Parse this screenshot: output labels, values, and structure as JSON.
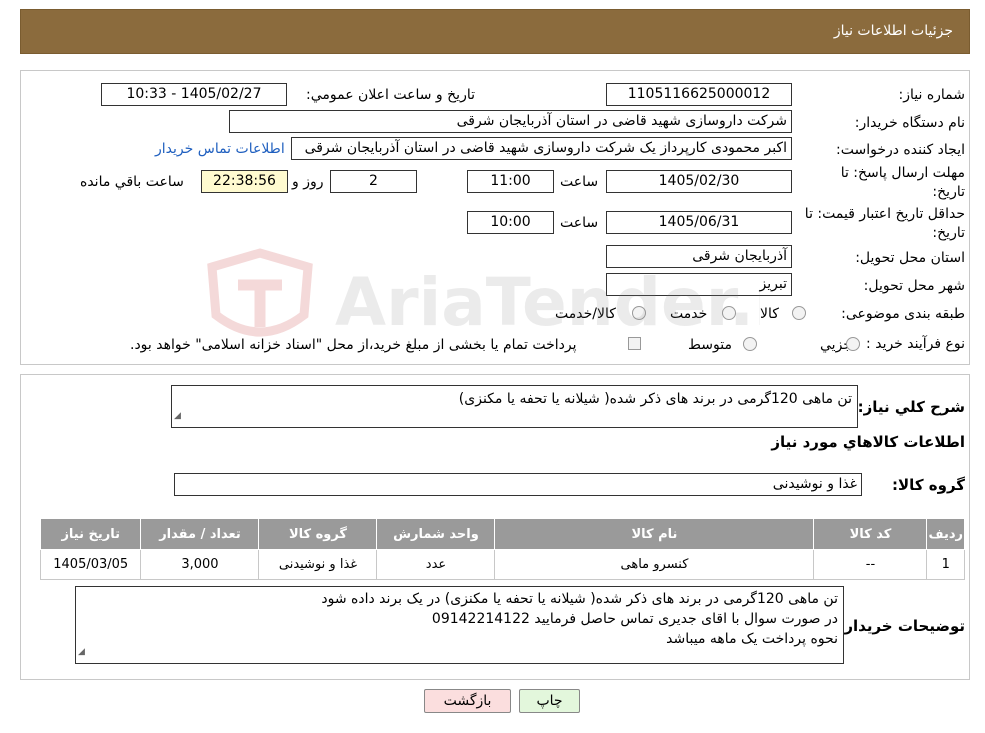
{
  "header": {
    "title": "جزئیات اطلاعات نیاز"
  },
  "info": {
    "need_number_label": "شماره نیاز:",
    "need_number": "1105116625000012",
    "announce_label": "تاریخ و ساعت اعلان عمومي:",
    "announce_value": "1405/02/27 - 10:33",
    "buyer_org_label": "نام دستگاه خریدار:",
    "buyer_org": "شرکت داروسازی شهید قاضی در استان آذربایجان شرقی",
    "creator_label": "ایجاد کننده درخواست:",
    "creator": "اکبر محمودی  کارپرداز یک  شرکت داروسازی شهید قاضی در استان آذربایجان شرقی",
    "contact_link": "اطلاعات تماس خریدار",
    "deadline_label_1": "مهلت ارسال پاسخ: تا",
    "deadline_label_2": "تاریخ:",
    "deadline_date": "1405/02/30",
    "time_label": "ساعت",
    "deadline_time": "11:00",
    "days_value": "2",
    "days_label": "روز و",
    "remaining_time": "22:38:56",
    "remaining_label": "ساعت باقي مانده",
    "validity_label_1": "حداقل تاریخ اعتبار قیمت: تا",
    "validity_label_2": "تاریخ:",
    "validity_date": "1405/06/31",
    "validity_time": "10:00",
    "province_label": "استان محل تحویل:",
    "province": "آذربایجان شرقی",
    "city_label": "شهر محل تحویل:",
    "city": "تبریز",
    "category_label": "طبقه بندی موضوعی:",
    "category_options": [
      "کالا",
      "خدمت",
      "کالا/خدمت"
    ],
    "process_label": "نوع فرآیند خرید :",
    "process_options": [
      "جزیي",
      "متوسط"
    ],
    "process_note": "پرداخت تمام یا بخشی از مبلغ خرید،از محل \"اسناد خزانه اسلامی\" خواهد بود."
  },
  "summary": {
    "label": "شرح کلي نیاز:",
    "text": "تن ماهی 120گرمی در برند های ذکر شده( شیلانه یا تحفه یا مکنزی)"
  },
  "goods": {
    "section_title": "اطلاعات کالاهاي مورد نیاز",
    "group_label": "گروه کالا:",
    "group_value": "غذا و نوشیدنی",
    "table": {
      "headers": [
        "ردیف",
        "کد کالا",
        "نام کالا",
        "واحد شمارش",
        "گروه کالا",
        "تعداد / مقدار",
        "تاریخ نیاز"
      ],
      "rows": [
        [
          "1",
          "--",
          "کنسرو ماهی",
          "عدد",
          "غذا و نوشیدنی",
          "3,000",
          "1405/03/05"
        ]
      ]
    }
  },
  "buyer_notes": {
    "label": "توضیحات خریدار:",
    "lines": [
      "تن ماهی 120گرمی در برند های ذکر شده( شیلانه یا تحفه یا مکنزی) در یک برند داده شود",
      "در صورت سوال با اقای جدیری تماس حاصل فرمایید 09142214122",
      "نحوه پرداخت یک ماهه میباشد"
    ]
  },
  "buttons": {
    "print": "چاپ",
    "back": "بازگشت"
  },
  "watermark": "AriaTender.neT",
  "colors": {
    "header": "#8b6b3d",
    "table_header": "#9a9a9a",
    "back_button": "#fbdede",
    "print_button": "#e3f7dc",
    "link": "#1f5fbf"
  }
}
